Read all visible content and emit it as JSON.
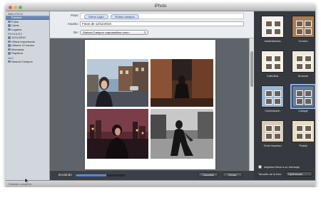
{
  "window": {
    "title": "iPhoto"
  },
  "traffic_lights": {
    "close": "#ec5f57",
    "minimize": "#e9b43a",
    "zoom": "#5fbd44"
  },
  "sidebar": {
    "sections": [
      {
        "title": "BIBLIOTECA",
        "items": [
          {
            "label": "Eventos",
            "icon": "events-icon",
            "selected": true
          },
          {
            "label": "Fotos",
            "icon": "photos-icon"
          },
          {
            "label": "Caras",
            "icon": "faces-icon"
          },
          {
            "label": "Lugares",
            "icon": "places-icon"
          }
        ]
      },
      {
        "title": "RECIENTES",
        "items": [
          {
            "label": "12/11/2010",
            "icon": "event-icon"
          },
          {
            "label": "Ultima importación",
            "icon": "import-icon"
          },
          {
            "label": "Ultimos 12 meses",
            "icon": "calendar-icon"
          },
          {
            "label": "Marcadas",
            "icon": "flag-icon"
          },
          {
            "label": "Papelera",
            "icon": "trash-icon"
          }
        ]
      },
      {
        "title": "MAC",
        "items": [
          {
            "label": "Samuel Campos",
            "icon": "mac-icon"
          }
        ]
      }
    ]
  },
  "compose": {
    "to_label": "Para:",
    "recipients": [
      "Elena Lujan",
      "Ruben campos"
    ],
    "subject_label": "Asunto:",
    "subject_value": "Fotos de 12/11/2010",
    "from_label": "De:",
    "from_value": "Samuel Campos <sqmanellme.com>"
  },
  "sendbar": {
    "sending_label": "Enviando",
    "progress": 0.62,
    "cancel_label": "Cancelar",
    "send_label": "Enviar"
  },
  "templates": {
    "items": [
      {
        "label": "Instantáneas",
        "style": "snapshots"
      },
      {
        "label": "Corcho",
        "style": "cork"
      },
      {
        "label": "Cartulina",
        "style": "cardstock"
      },
      {
        "label": "Anuncio",
        "style": "announcement"
      },
      {
        "label": "Celebración",
        "style": "celebration"
      },
      {
        "label": "Collage",
        "style": "collage",
        "selected": true
      },
      {
        "label": "Texto impreso",
        "style": "print"
      },
      {
        "label": "Postal",
        "style": "postcard"
      }
    ],
    "attach_label": "Adjuntar fotos a un mensaje",
    "attach_checked": true,
    "size_label": "Tamaño de la foto:",
    "size_value": "Optimizado"
  },
  "statusbar": {
    "text": "Pantalla completa"
  },
  "colors": {
    "accent": "#5b78a6",
    "panel": "#363a40",
    "selection": "#8ab4ec"
  }
}
